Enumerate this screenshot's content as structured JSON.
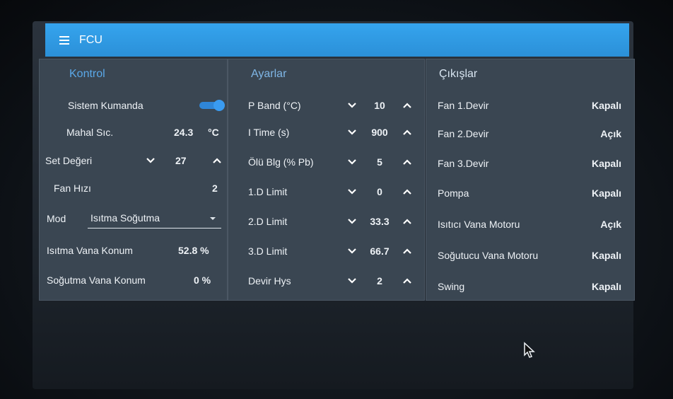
{
  "app": {
    "title": "FCU"
  },
  "kontrol": {
    "title": "Kontrol",
    "sistem_kumanda": {
      "label": "Sistem Kumanda",
      "state": "on"
    },
    "mahal_sic": {
      "label": "Mahal Sıc.",
      "value": "24.3",
      "unit": "°C"
    },
    "set_degeri": {
      "label": "Set Değeri",
      "value": "27"
    },
    "fan_hizi": {
      "label": "Fan Hızı",
      "value": "2"
    },
    "mod": {
      "label": "Mod",
      "value": "Isıtma Soğutma"
    },
    "isitma_vana": {
      "label": "Isıtma Vana Konum",
      "value": "52.8 %"
    },
    "sogutma_vana": {
      "label": "Soğutma Vana Konum",
      "value": "0 %"
    }
  },
  "ayarlar": {
    "title": "Ayarlar",
    "rows": [
      {
        "label": "P Band (°C)",
        "value": "10"
      },
      {
        "label": "I Time (s)",
        "value": "900"
      },
      {
        "label": "Ölü Blg (% Pb)",
        "value": "5"
      },
      {
        "label": "1.D Limit",
        "value": "0"
      },
      {
        "label": "2.D Limit",
        "value": "33.3"
      },
      {
        "label": "3.D Limit",
        "value": "66.7"
      },
      {
        "label": "Devir Hys",
        "value": "2"
      }
    ]
  },
  "cikislar": {
    "title": "Çıkışlar",
    "rows": [
      {
        "label": "Fan 1.Devir",
        "value": "Kapalı"
      },
      {
        "label": "Fan 2.Devir",
        "value": "Açık"
      },
      {
        "label": "Fan 3.Devir",
        "value": "Kapalı"
      },
      {
        "label": "Pompa",
        "value": "Kapalı"
      },
      {
        "label": "Isıtıcı Vana Motoru",
        "value": "Açık"
      },
      {
        "label": "Soğutucu Vana Motoru",
        "value": "Kapalı"
      },
      {
        "label": "Swing",
        "value": "Kapalı"
      }
    ]
  },
  "colors": {
    "accent": "#2f95e0",
    "panel": "#3a4652",
    "title_blue": "#5aa8e8"
  },
  "icons": {
    "menu": "menu-icon",
    "down": "chevron-down-icon",
    "up": "chevron-up-icon",
    "cursor": "mouse-pointer-icon"
  }
}
